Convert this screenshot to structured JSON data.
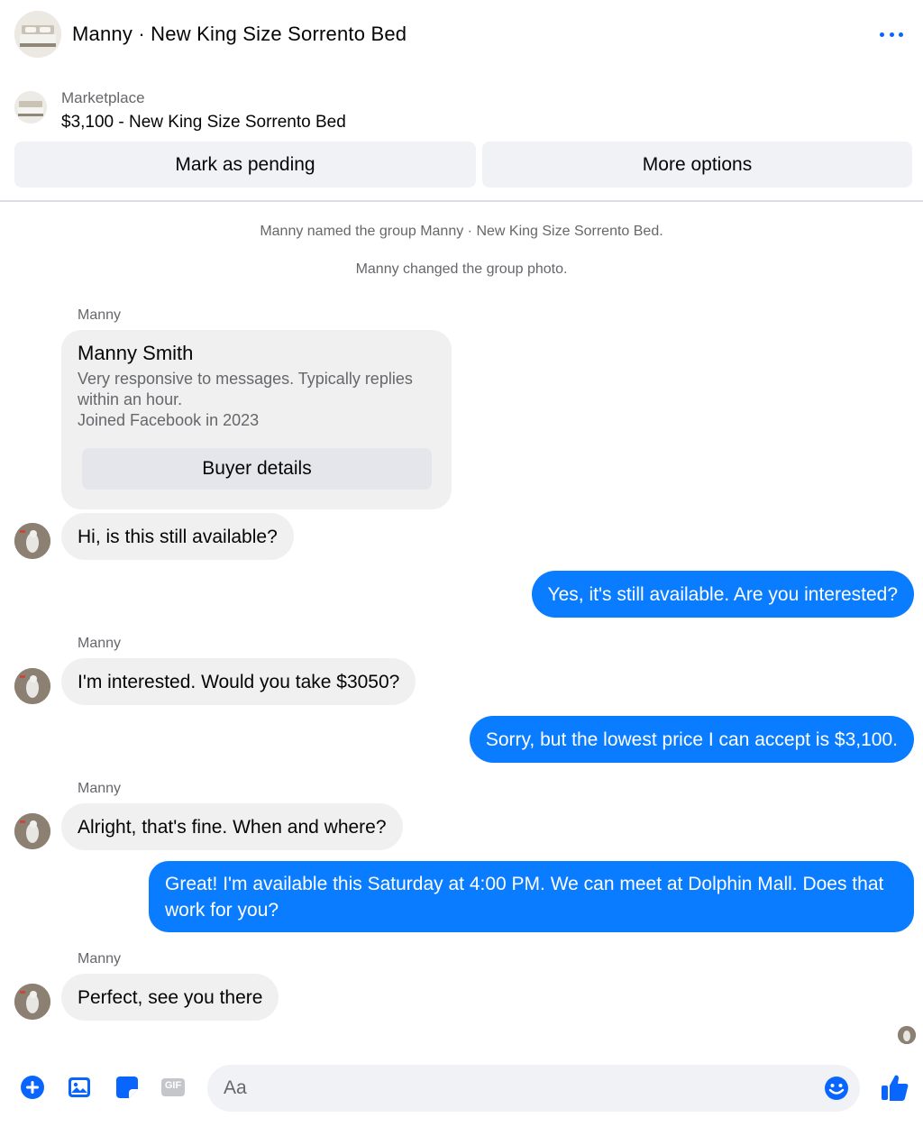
{
  "header": {
    "title": "Manny · New King Size Sorrento Bed",
    "more_icon": "more-horizontal-icon"
  },
  "listing": {
    "label": "Marketplace",
    "price_title": "$3,100 - New King Size Sorrento Bed"
  },
  "actions": {
    "pending": "Mark as pending",
    "more": "More options"
  },
  "system_messages": [
    "Manny named the group Manny · New King Size Sorrento Bed.",
    "Manny changed the group photo."
  ],
  "profile_card": {
    "sender": "Manny",
    "name": "Manny Smith",
    "line1": "Very responsive to messages. Typically replies within an hour.",
    "line2": "Joined Facebook in 2023",
    "button": "Buyer details"
  },
  "messages": [
    {
      "from": "Manny",
      "text": "Hi, is this still available?"
    },
    {
      "from": "me",
      "text": "Yes, it's still available. Are you interested?"
    },
    {
      "from": "Manny",
      "sender_label": "Manny",
      "text": "I'm interested. Would you take $3050?"
    },
    {
      "from": "me",
      "text": "Sorry, but the lowest price I can accept is $3,100."
    },
    {
      "from": "Manny",
      "sender_label": "Manny",
      "text": "Alright, that's fine. When and where?"
    },
    {
      "from": "me",
      "text": "Great! I'm available this Saturday at 4:00 PM. We can meet at Dolphin Mall. Does that work for you?"
    },
    {
      "from": "Manny",
      "sender_label": "Manny",
      "text": "Perfect, see you there"
    }
  ],
  "composer": {
    "placeholder": "Aa",
    "icons": [
      "plus-circle-icon",
      "photo-icon",
      "sticker-icon",
      "gif-icon",
      "emoji-icon",
      "thumbs-up-icon"
    ],
    "gif_label": "GIF"
  },
  "colors": {
    "accent": "#0866ff",
    "outgoing_bubble": "#0a7cff",
    "incoming_bubble": "#f0f0f0",
    "secondary_text": "#65676b"
  }
}
